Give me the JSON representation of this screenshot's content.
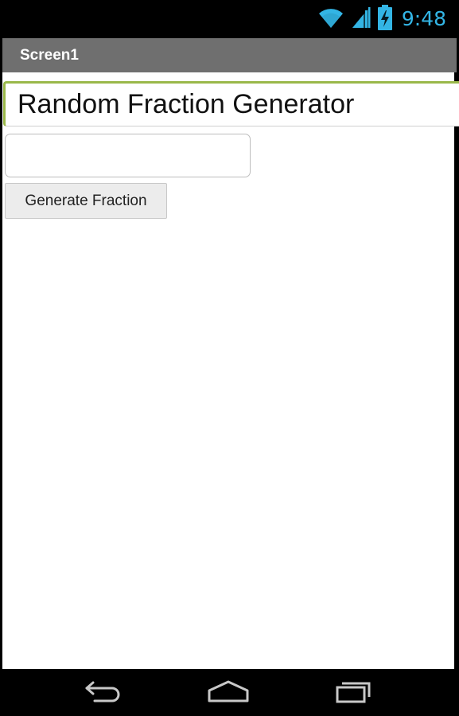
{
  "status_bar": {
    "time": "9:48",
    "icons": [
      "wifi-icon",
      "cell-signal-icon",
      "battery-charging-icon"
    ],
    "accent_color": "#33b5e5"
  },
  "title_bar": {
    "title": "Screen1"
  },
  "content": {
    "title_label": "Random Fraction Generator",
    "text_input": {
      "value": "",
      "placeholder": ""
    },
    "generate_button": "Generate Fraction"
  },
  "nav_bar": {
    "buttons": [
      "back-icon",
      "home-icon",
      "recent-apps-icon"
    ]
  },
  "colors": {
    "title_bar_bg": "#6f6f6f",
    "label_accent": "#9ab84a",
    "content_bg": "#ffffff"
  }
}
